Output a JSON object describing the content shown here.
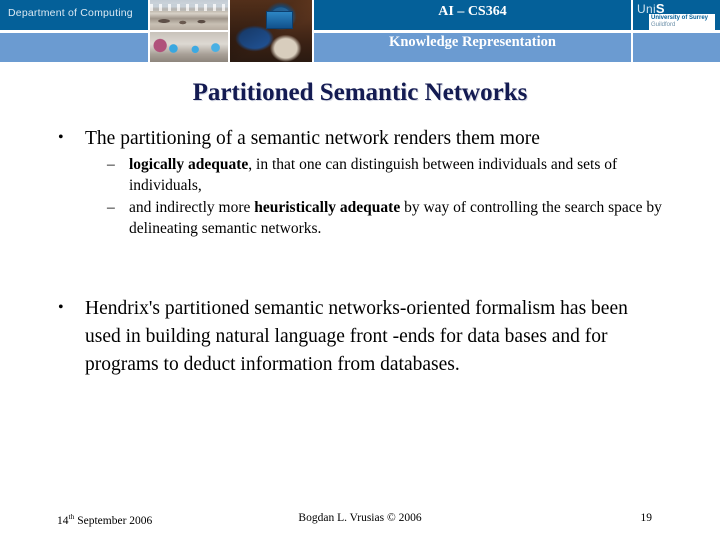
{
  "header": {
    "department_label": "Department of Computing",
    "course_code": "AI – CS364",
    "course_topic": "Knowledge Representation",
    "logo": {
      "mark_prefix": "Uni",
      "mark_suffix": "S",
      "line1": "University of Surrey",
      "line2": "Guildford"
    },
    "colors": {
      "band_dark": "#046099",
      "band_light": "#6b9bd1",
      "banner_text": "#ffffff"
    }
  },
  "slide": {
    "title": "Partitioned Semantic Networks",
    "title_color": "#141b52",
    "bullet_marker": "•",
    "dash_marker": "–",
    "bullets": [
      {
        "text": "The partitioning of a semantic network renders them more",
        "sub": [
          {
            "bold": "logically adequate",
            "rest": ", in that one can distinguish between individuals and sets of individuals,"
          },
          {
            "lead": "and indirectly more ",
            "bold": "heuristically adequate",
            "rest": " by way of controlling the search space by delineating semantic networks."
          }
        ]
      }
    ],
    "bullet2": "Hendrix's partitioned semantic networks-oriented formalism has been used in building natural language front -ends for data bases and for programs to deduct information from databases."
  },
  "footer": {
    "date_number": "14",
    "date_ordinal": "th",
    "date_rest": " September 2006",
    "author": "Bogdan L. Vrusias © 2006",
    "page": "19"
  }
}
